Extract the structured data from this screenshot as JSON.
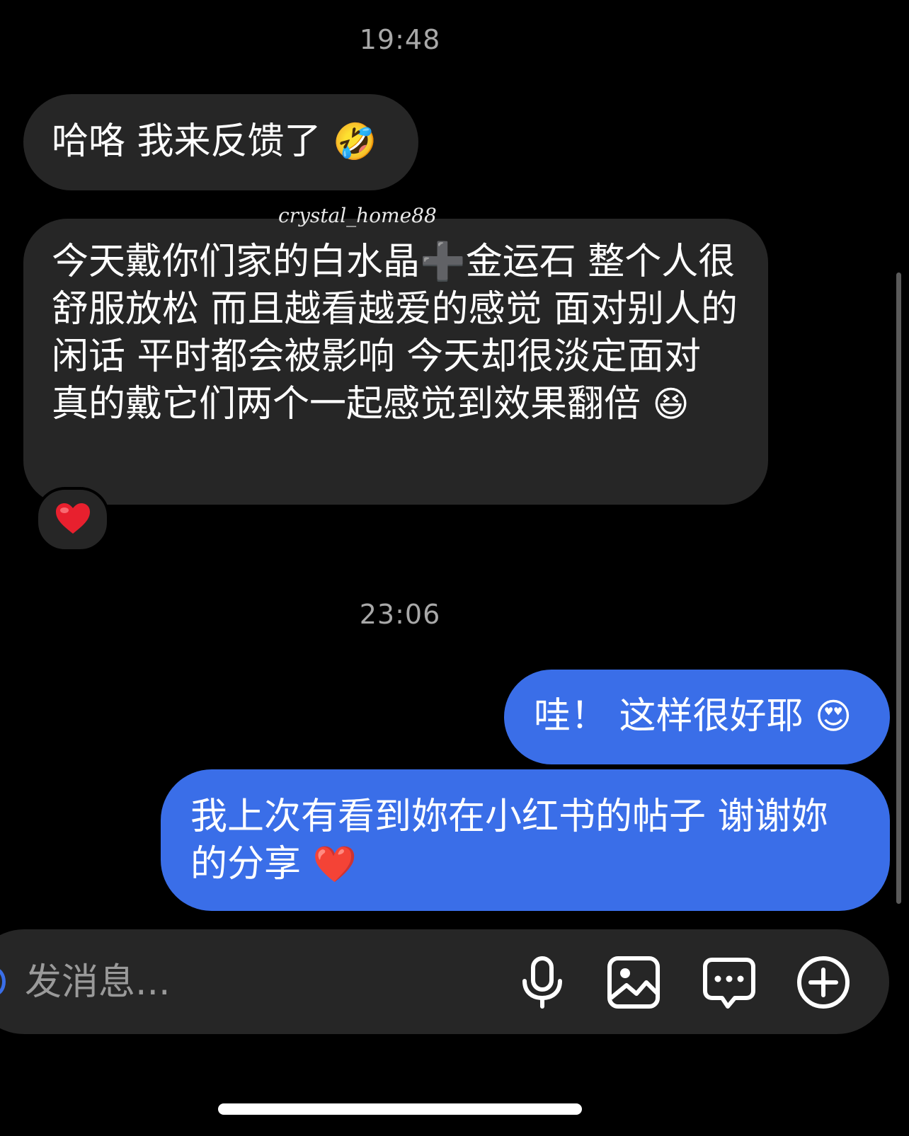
{
  "conversation": {
    "timestamps": [
      "19:48",
      "23:06"
    ],
    "messages": [
      {
        "direction": "incoming",
        "text": "哈咯 我来反馈了",
        "emoji": "🤣"
      },
      {
        "direction": "incoming",
        "text": "今天戴你们家的白水晶➕金运石 整个人很舒服放松 而且越看越爱的感觉 面对别人的闲话 平时都会被影响 今天却很淡定面对 真的戴它们两个一起感觉到效果翻倍",
        "emoji": "😆",
        "reaction": "heart"
      },
      {
        "direction": "outgoing",
        "text": "哇！ 这样很好耶",
        "emoji": "😍"
      },
      {
        "direction": "outgoing",
        "text": "我上次有看到妳在小红书的帖子 谢谢妳的分享",
        "emoji": "❤️"
      }
    ],
    "watermark": "crystal_home88"
  },
  "composer": {
    "placeholder": "发消息...",
    "icons": [
      "microphone-icon",
      "image-icon",
      "sticker-message-icon",
      "plus-circle-icon"
    ]
  },
  "colors": {
    "background": "#000000",
    "incoming_bubble": "#262626",
    "outgoing_bubble": "#3a6ee8",
    "timestamp": "#a8a8a8",
    "placeholder": "#9a9a9a",
    "heart": "#e8202e"
  }
}
